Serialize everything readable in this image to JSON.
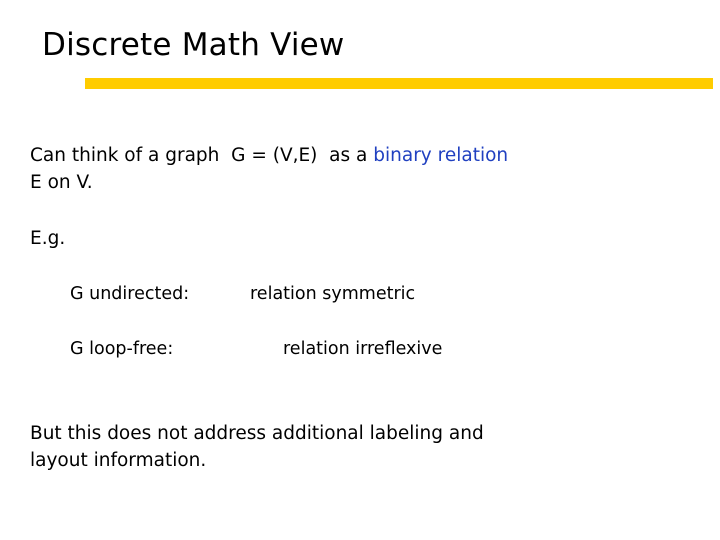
{
  "slide": {
    "title": "Discrete Math View",
    "accent_color": "#ffcc00",
    "highlight_color": "#2040c0",
    "text_color": "#000000",
    "background_color": "#ffffff"
  },
  "body": {
    "intro": {
      "before_highlight": "Can think of a graph  G = (V,E)  as a ",
      "highlight": "binary relation",
      "after_highlight": "\nE on V."
    },
    "example_label": "E.g.",
    "rows": [
      {
        "label": "G undirected:",
        "value": "relation symmetric"
      },
      {
        "label": "G loop-free:",
        "value": "relation irreflexive"
      }
    ],
    "closing": "But this does not address additional labeling and\nlayout information."
  }
}
